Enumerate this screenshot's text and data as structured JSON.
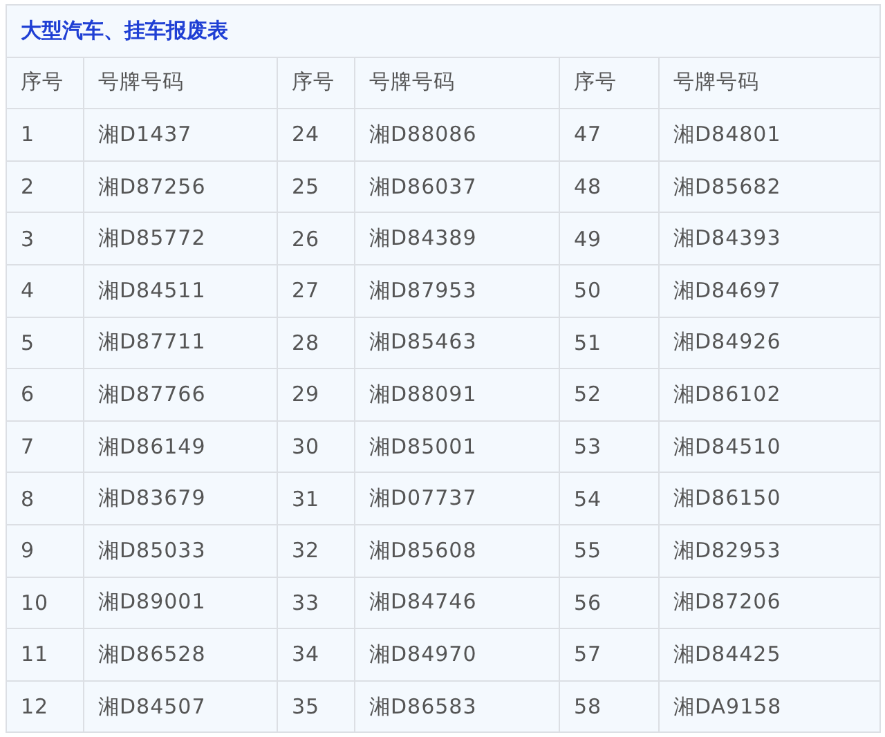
{
  "table": {
    "title": "大型汽车、挂车报废表",
    "columns": [
      "序号",
      "号牌号码",
      "序号",
      "号牌号码",
      "序号",
      "号牌号码"
    ],
    "rows": [
      {
        "cells": [
          "1",
          "湘D1437",
          "24",
          "湘D88086",
          "47",
          "湘D84801"
        ]
      },
      {
        "cells": [
          "2",
          "湘D87256",
          "25",
          "湘D86037",
          "48",
          "湘D85682"
        ]
      },
      {
        "cells": [
          "3",
          "湘D85772",
          "26",
          "湘D84389",
          "49",
          "湘D84393"
        ]
      },
      {
        "cells": [
          "4",
          "湘D84511",
          "27",
          "湘D87953",
          "50",
          "湘D84697"
        ]
      },
      {
        "cells": [
          "5",
          "湘D87711",
          "28",
          "湘D85463",
          "51",
          "湘D84926"
        ]
      },
      {
        "cells": [
          "6",
          "湘D87766",
          "29",
          "湘D88091",
          "52",
          "湘D86102"
        ]
      },
      {
        "cells": [
          "7",
          "湘D86149",
          "30",
          "湘D85001",
          "53",
          "湘D84510"
        ]
      },
      {
        "cells": [
          "8",
          "湘D83679",
          "31",
          "湘D07737",
          "54",
          "湘D86150"
        ]
      },
      {
        "cells": [
          "9",
          "湘D85033",
          "32",
          "湘D85608",
          "55",
          "湘D82953"
        ]
      },
      {
        "cells": [
          "10",
          "湘D89001",
          "33",
          "湘D84746",
          "56",
          "湘D87206"
        ]
      },
      {
        "cells": [
          "11",
          "湘D86528",
          "34",
          "湘D84970",
          "57",
          "湘D84425"
        ]
      },
      {
        "cells": [
          "12",
          "湘D84507",
          "35",
          "湘D86583",
          "58",
          "湘DA9158"
        ]
      }
    ]
  }
}
